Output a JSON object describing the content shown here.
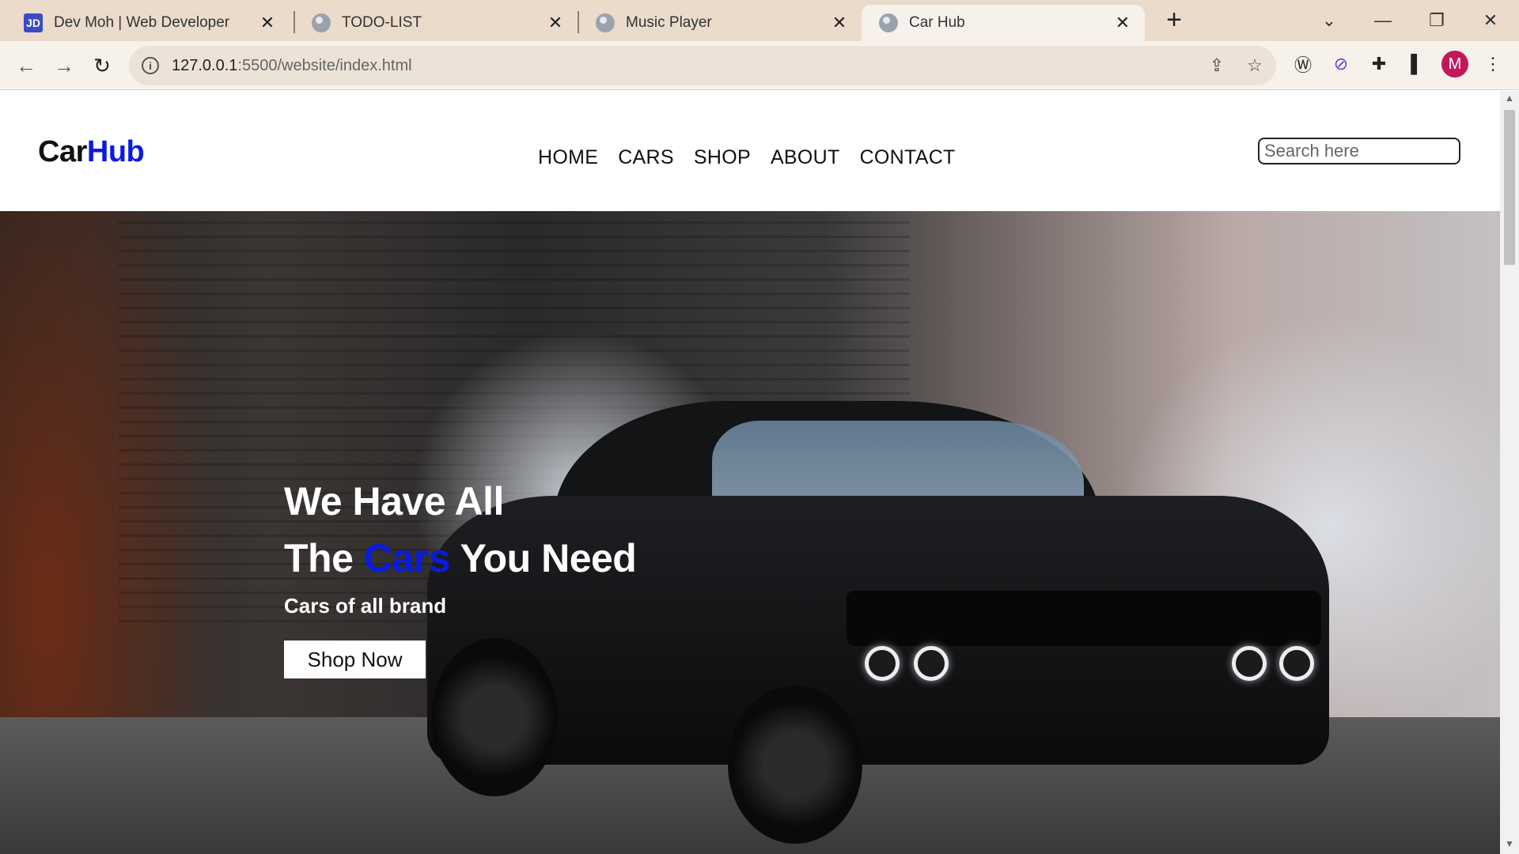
{
  "browser": {
    "tabs": [
      {
        "title": "Dev Moh | Web Developer",
        "favicon": "JD"
      },
      {
        "title": "TODO-LIST",
        "favicon": "globe-icon"
      },
      {
        "title": "Music Player",
        "favicon": "globe-icon"
      },
      {
        "title": "Car Hub",
        "favicon": "globe-icon",
        "active": true
      }
    ],
    "url_host": "127.0.0.1",
    "url_rest": ":5500/website/index.html",
    "profile_initial": "M"
  },
  "site": {
    "logo_part1": "Car",
    "logo_part2": "Hub",
    "nav": [
      "HOME",
      "CARS",
      "SHOP",
      "ABOUT",
      "CONTACT"
    ],
    "search_placeholder": "Search here"
  },
  "hero": {
    "line1": "We Have All",
    "line2_before": "The ",
    "line2_highlight": "Cars",
    "line2_after": " You Need",
    "subtitle": "Cars of all brand",
    "button": "Shop Now"
  },
  "colors": {
    "accent": "#0a1be0",
    "tabbar": "#eadbcb",
    "toolbar": "#f7f1ec"
  }
}
